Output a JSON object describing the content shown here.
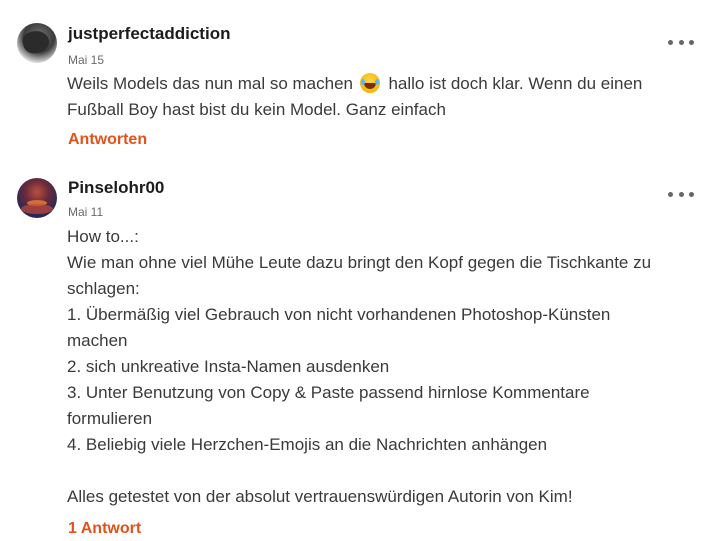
{
  "comments": [
    {
      "username": "justperfectaddiction",
      "date": "Mai 15",
      "text_before_emoji": "Weils Models das nun mal so machen",
      "emoji": "face-with-tears-of-joy",
      "text_after_emoji": "hallo ist doch klar. Wenn du einen",
      "line2": "Fußball Boy hast bist du kein Model. Ganz einfach",
      "reply_label": "Antworten"
    },
    {
      "username": "Pinselohr00",
      "date": "Mai 11",
      "lines": [
        "How to...:",
        "Wie man ohne viel Mühe Leute dazu bringt den Kopf gegen die Tischkante zu",
        "schlagen:",
        "1. Übermäßig viel Gebrauch von nicht vorhandenen Photoshop-Künsten",
        "machen",
        "2. sich unkreative Insta-Namen ausdenken",
        "3. Unter Benutzung von Copy & Paste passend hirnlose Kommentare",
        "formulieren",
        "4. Beliebig viele Herzchen-Emojis an die Nachrichten anhängen",
        "",
        "Alles getestet von der absolut vertrauenswürdigen Autorin von Kim!"
      ],
      "reply_label": "1 Antwort"
    }
  ],
  "colors": {
    "accent": "#e0531b",
    "text": "#3a3a3a",
    "muted": "#6a6a6a"
  }
}
